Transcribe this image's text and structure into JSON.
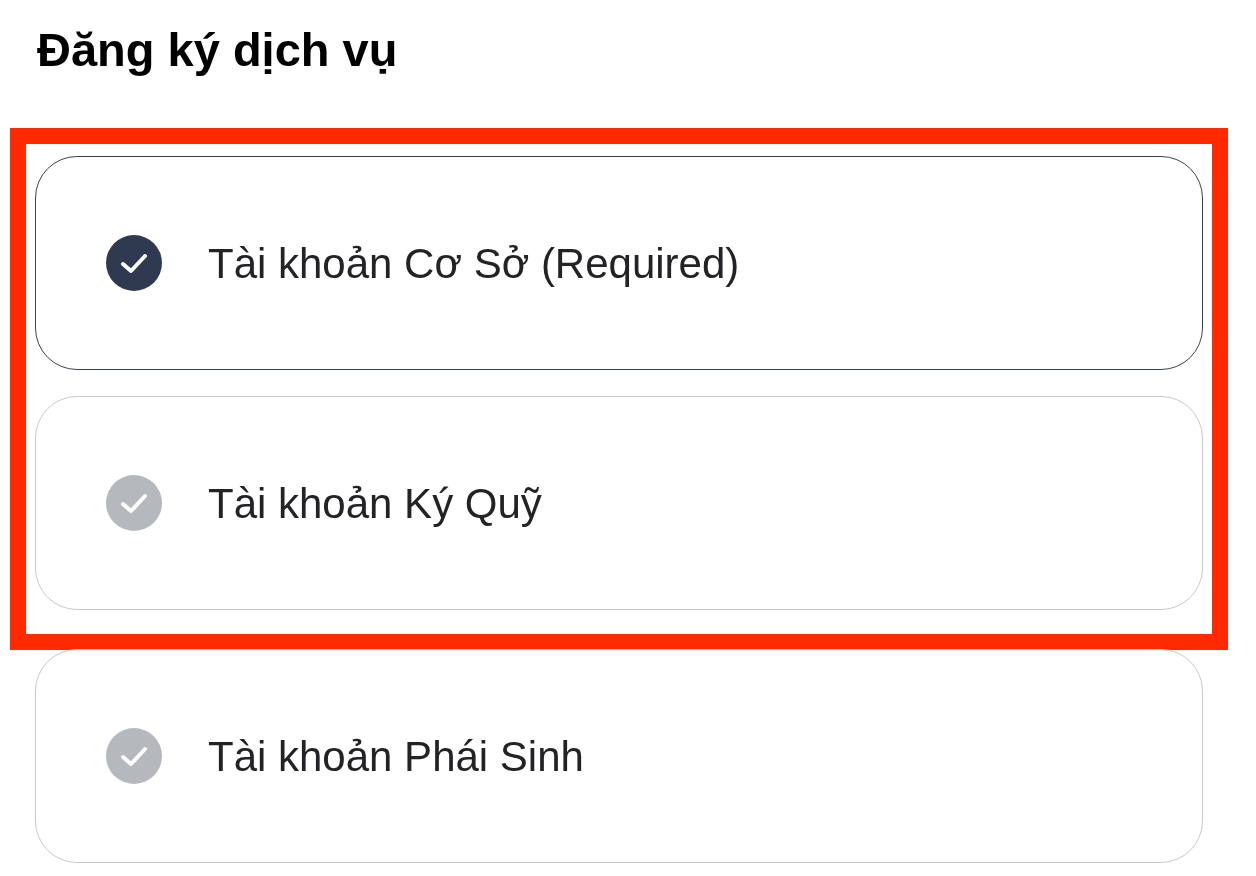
{
  "title": "Đăng ký dịch vụ",
  "services": [
    {
      "label": "Tài khoản Cơ Sở (Required)",
      "checked": true,
      "highlighted": true
    },
    {
      "label": "Tài khoản Ký Quỹ",
      "checked": false,
      "highlighted": true
    },
    {
      "label": "Tài khoản Phái Sinh",
      "checked": false,
      "highlighted": false
    }
  ]
}
